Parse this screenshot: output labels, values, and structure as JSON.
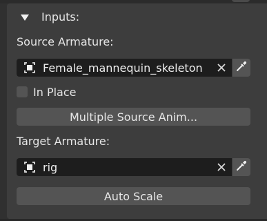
{
  "section": {
    "title": "Inputs:"
  },
  "source_armature": {
    "label": "Source Armature:",
    "value": "Female_mannequin_skeleton",
    "clear_icon": "x-clear-icon",
    "eyedropper_icon": "eyedropper-icon",
    "object_icon": "armature-object-icon"
  },
  "in_place": {
    "label": "In Place",
    "checked": false
  },
  "multiple_source_button": {
    "label": "Multiple Source Anim..."
  },
  "target_armature": {
    "label": "Target Armature:",
    "value": "rig",
    "clear_icon": "x-clear-icon",
    "eyedropper_icon": "eyedropper-icon",
    "object_icon": "armature-object-icon"
  },
  "auto_scale_button": {
    "label": "Auto Scale"
  },
  "colors": {
    "panel_bg": "#3d3d3d",
    "field_bg": "#1d1d1d",
    "button_bg": "#545454",
    "text": "#e6e6e6"
  }
}
